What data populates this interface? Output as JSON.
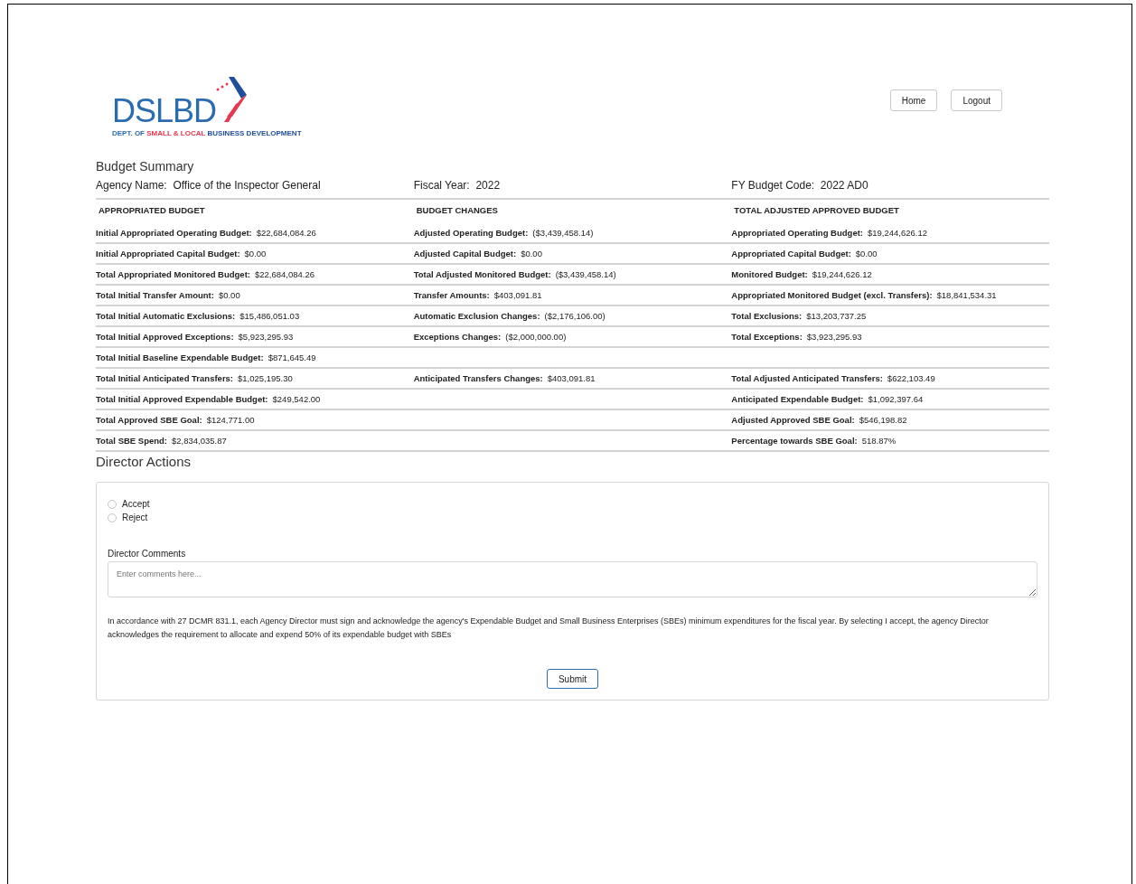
{
  "logo": {
    "mark": "DSLBD",
    "tagline": [
      {
        "text": "DEPT. OF ",
        "color": "#2b6cb0"
      },
      {
        "text": "SMALL & LOCAL ",
        "color": "#e5384f"
      },
      {
        "text": "BUSINESS DEVELOPMENT",
        "color": "#1f4e9c"
      }
    ]
  },
  "nav": [
    "Home",
    "Logout"
  ],
  "summary": {
    "title": "Budget Summary",
    "info": [
      {
        "label": "Agency Name:",
        "value": "Office of the Inspector General"
      },
      {
        "label": "Fiscal Year:",
        "value": "2022"
      },
      {
        "label": "FY Budget Code:",
        "value": "2022 AD0"
      }
    ],
    "columns": [
      "APPROPRIATED BUDGET",
      "BUDGET CHANGES",
      "TOTAL ADJUSTED APPROVED BUDGET"
    ],
    "rows": [
      [
        {
          "label": "Initial Appropriated Operating Budget:",
          "value": "$22,684,084.26"
        },
        {
          "label": "Adjusted Operating Budget:",
          "value": "($3,439,458.14)"
        },
        {
          "label": "Appropriated Operating Budget:",
          "value": "$19,244,626.12"
        }
      ],
      [
        {
          "label": "Initial Appropriated Capital Budget:",
          "value": "$0.00"
        },
        {
          "label": "Adjusted Capital Budget:",
          "value": "$0.00"
        },
        {
          "label": "Appropriated Capital Budget:",
          "value": "$0.00"
        }
      ],
      [
        {
          "label": "Total Appropriated Monitored Budget:",
          "value": "$22,684,084.26"
        },
        {
          "label": "Total Adjusted Monitored Budget:",
          "value": "($3,439,458.14)"
        },
        {
          "label": "Monitored Budget:",
          "value": "$19,244,626.12"
        }
      ],
      [
        {
          "label": "Total Initial Transfer Amount:",
          "value": "$0.00"
        },
        {
          "label": "Transfer Amounts:",
          "value": "$403,091.81"
        },
        {
          "label": "Appropriated Monitored Budget (excl. Transfers):",
          "value": "$18,841,534.31"
        }
      ],
      [
        {
          "label": "Total Initial Automatic Exclusions:",
          "value": "$15,486,051.03"
        },
        {
          "label": "Automatic Exclusion Changes:",
          "value": "($2,176,106.00)"
        },
        {
          "label": "Total Exclusions:",
          "value": "$13,203,737.25"
        }
      ],
      [
        {
          "label": "Total Initial Approved Exceptions:",
          "value": "$5,923,295.93"
        },
        {
          "label": "Exceptions Changes:",
          "value": "($2,000,000.00)"
        },
        {
          "label": "Total Exceptions:",
          "value": "$3,923,295.93"
        }
      ],
      [
        {
          "label": "Total Initial Baseline Expendable Budget:",
          "value": "$871,645.49"
        },
        null,
        null
      ],
      [
        {
          "label": "Total Initial Anticipated Transfers:",
          "value": "$1,025,195.30"
        },
        {
          "label": "Anticipated Transfers Changes:",
          "value": "$403,091.81"
        },
        {
          "label": "Total Adjusted Anticipated Transfers:",
          "value": "$622,103.49"
        }
      ],
      [
        {
          "label": "Total Initial Approved Expendable Budget:",
          "value": "$249,542.00"
        },
        null,
        {
          "label": "Anticipated Expendable Budget:",
          "value": "$1,092,397.64"
        }
      ],
      [
        {
          "label": "Total Approved SBE Goal:",
          "value": "$124,771.00"
        },
        null,
        {
          "label": "Adjusted Approved SBE Goal:",
          "value": "$546,198.82"
        }
      ],
      [
        {
          "label": "Total SBE Spend:",
          "value": "$2,834,035.87"
        },
        null,
        {
          "label": "Percentage towards SBE Goal:",
          "value": "518.87%"
        }
      ]
    ]
  },
  "director": {
    "title": "Director Actions",
    "options": [
      {
        "label": "Accept",
        "selected": false
      },
      {
        "label": "Reject",
        "selected": false
      }
    ],
    "comments": {
      "label": "Director Comments",
      "placeholder": "Enter comments here..."
    },
    "notice": "In accordance with 27 DCMR 831.1, each Agency Director must sign and acknowledge the agency's Expendable Budget and Small Business Enterprises (SBEs) minimum expenditures for the fiscal year. By selecting I accept, the agency Director acknowledges the requirement to allocate and expend 50% of its expendable budget with SBEs",
    "submit": "Submit"
  }
}
